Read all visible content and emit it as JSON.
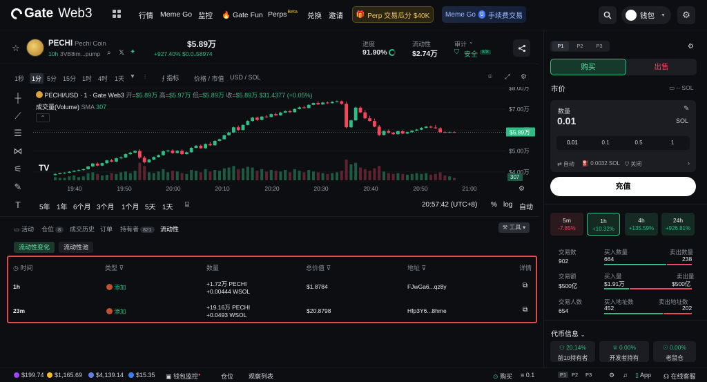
{
  "nav": {
    "brand": "Gate",
    "brand_suffix": "Web3",
    "items": [
      "行情",
      "Meme Go",
      "监控",
      "Gate Fun",
      "Perps",
      "兑换",
      "邀请"
    ],
    "perps_badge": "Beta",
    "perp_banner": "Perp 交易瓜分 $40K",
    "memego_banner_a": "Meme Go",
    "memego_banner_b": "手续费交易",
    "wallet_label": "钱包"
  },
  "token": {
    "symbol": "PECHI",
    "name": "Pechi Coin",
    "age": "10h",
    "address_short": "3VB8im...pump",
    "price": "$5.89万",
    "change": "+927.40%",
    "sub_value": "$0.0₄58974",
    "progress_label": "进度",
    "progress_value": "91.90%",
    "liquidity_label": "流动性",
    "liquidity_value": "$2.74万",
    "audit_label": "审计",
    "audit_value": "安全",
    "audit_count": "8/8"
  },
  "chart_toolbar": {
    "intervals": [
      "1秒",
      "1分",
      "5分",
      "15分",
      "1时",
      "4时",
      "1天"
    ],
    "active_interval": "1分",
    "indicator": "指标",
    "price_mcap": "价格 / 市值",
    "pair_toggle": "USD / SOL"
  },
  "chart_legend": {
    "pair": "PECHI/USD · 1 · Gate Web3",
    "open_label": "开=",
    "open": "$5.89万",
    "high_label": "高=",
    "high": "$5.97万",
    "low_label": "低=",
    "low": "$5.89万",
    "close_label": "收=",
    "close": "$5.89万",
    "change": "$31.4377 (+0.05%)",
    "volume_label": "成交量(Volume)",
    "volume_ma": "SMA",
    "volume_ma_value": "307"
  },
  "chart_data": {
    "type": "candlestick",
    "title": "PECHI/USD · 1 · Gate Web3",
    "y_ticks": [
      "$8.00万",
      "$7.00万",
      "$6.00万",
      "$5.00万",
      "$4.00万"
    ],
    "y_tick_values": [
      80000,
      70000,
      60000,
      50000,
      40000
    ],
    "ylim": [
      36000,
      80500
    ],
    "x_ticks": [
      "19:40",
      "19:50",
      "20:00",
      "20:10",
      "20:20",
      "20:30",
      "20:40",
      "20:50",
      "21:00"
    ],
    "current_price_label": "$5.89万",
    "current_price": 58900,
    "volume_last_label": "307",
    "candles_ohlc": [
      [
        38500,
        39300,
        38300,
        39000
      ],
      [
        39000,
        39600,
        38800,
        39400
      ],
      [
        39400,
        39800,
        39100,
        39600
      ],
      [
        39600,
        40300,
        39400,
        40100
      ],
      [
        40100,
        40800,
        39900,
        40500
      ],
      [
        40500,
        41200,
        40300,
        40900
      ],
      [
        40900,
        41600,
        40500,
        41300
      ],
      [
        41300,
        42900,
        41100,
        42600
      ],
      [
        42600,
        44300,
        42400,
        44000
      ],
      [
        44000,
        44600,
        42700,
        43000
      ],
      [
        43000,
        44400,
        42800,
        44200
      ],
      [
        44200,
        45800,
        43900,
        45500
      ],
      [
        45500,
        46200,
        44600,
        44900
      ],
      [
        44900,
        46800,
        44700,
        46500
      ],
      [
        46500,
        47400,
        46100,
        46900
      ],
      [
        46900,
        48800,
        46600,
        48500
      ],
      [
        48500,
        49600,
        48100,
        49200
      ],
      [
        49200,
        50400,
        48900,
        50000
      ],
      [
        50000,
        50800,
        46200,
        46800
      ],
      [
        46800,
        47600,
        44100,
        44600
      ],
      [
        44600,
        46200,
        44300,
        45900
      ],
      [
        45900,
        47400,
        45600,
        47100
      ],
      [
        47100,
        48300,
        46900,
        48000
      ],
      [
        48000,
        50200,
        47800,
        49900
      ],
      [
        49900,
        50600,
        49400,
        50200
      ],
      [
        50200,
        50800,
        48700,
        49000
      ],
      [
        49000,
        50400,
        48800,
        50100
      ],
      [
        50100,
        50700,
        48200,
        48500
      ],
      [
        48500,
        49700,
        48300,
        49400
      ],
      [
        49400,
        51800,
        49200,
        51500
      ],
      [
        51500,
        52800,
        51300,
        52500
      ],
      [
        52500,
        53100,
        51000,
        51300
      ],
      [
        51300,
        53600,
        51100,
        53300
      ],
      [
        53300,
        54200,
        52400,
        52700
      ],
      [
        52700,
        55100,
        52500,
        54800
      ],
      [
        54800,
        55900,
        54600,
        55600
      ],
      [
        55600,
        57800,
        55400,
        57500
      ],
      [
        57500,
        59200,
        57300,
        58800
      ],
      [
        58800,
        61600,
        58600,
        61300
      ],
      [
        61300,
        62100,
        59600,
        60000
      ],
      [
        60000,
        62700,
        59800,
        62400
      ],
      [
        62400,
        64700,
        62200,
        64300
      ],
      [
        64300,
        66200,
        64100,
        65900
      ],
      [
        65900,
        66400,
        64300,
        64800
      ],
      [
        64800,
        66700,
        64600,
        66400
      ],
      [
        66400,
        67100,
        65800,
        66200
      ],
      [
        66200,
        67900,
        66000,
        67600
      ],
      [
        67600,
        68300,
        66700,
        67000
      ],
      [
        67000,
        68600,
        66800,
        68300
      ],
      [
        68300,
        69300,
        68100,
        69000
      ],
      [
        69000,
        69500,
        68100,
        68500
      ],
      [
        68500,
        70300,
        68300,
        70000
      ],
      [
        70000,
        71200,
        69800,
        70800
      ],
      [
        70800,
        71500,
        70200,
        70500
      ],
      [
        70500,
        72300,
        70300,
        72000
      ],
      [
        72000,
        73100,
        71800,
        72900
      ],
      [
        72900,
        73700,
        71900,
        72200
      ],
      [
        72200,
        73400,
        72000,
        73100
      ],
      [
        73100,
        73600,
        72400,
        72800
      ],
      [
        72800,
        73800,
        72600,
        73400
      ],
      [
        73400,
        74100,
        73100,
        73700
      ],
      [
        73700,
        74100,
        72100,
        72500
      ],
      [
        72500,
        73600,
        60800,
        61300
      ],
      [
        61300,
        64900,
        61000,
        64600
      ],
      [
        64600,
        71100,
        64400,
        70700
      ],
      [
        70700,
        71300,
        68000,
        68400
      ],
      [
        68400,
        69500,
        65200,
        65600
      ],
      [
        65600,
        66800,
        64000,
        64300
      ],
      [
        64300,
        65500,
        61300,
        61600
      ],
      [
        61600,
        62400,
        57100,
        57600
      ],
      [
        57600,
        59800,
        57400,
        59500
      ],
      [
        59500,
        60200,
        58300,
        58700
      ],
      [
        58700,
        59100,
        57700,
        58000
      ],
      [
        58000,
        59700,
        57800,
        59400
      ],
      [
        59400,
        60000,
        58000,
        58300
      ],
      [
        58300,
        59300,
        58100,
        59000
      ],
      [
        59000,
        59900,
        58800,
        59700
      ],
      [
        59700,
        60500,
        59500,
        60200
      ],
      [
        60200,
        61300,
        60000,
        61000
      ],
      [
        61000,
        61900,
        60800,
        61600
      ],
      [
        61600,
        62100,
        60900,
        61200
      ],
      [
        61200,
        62400,
        60500,
        60800
      ],
      [
        60800,
        61300,
        58600,
        59000
      ],
      [
        59000,
        59500,
        58500,
        58900
      ],
      [
        58900,
        59300,
        58700,
        59000
      ],
      [
        59000,
        59400,
        58700,
        58900
      ]
    ],
    "volume": [
      4,
      3,
      3,
      5,
      6,
      4,
      5,
      9,
      10,
      8,
      6,
      7,
      9,
      8,
      10,
      11,
      9,
      12,
      22,
      18,
      10,
      9,
      11,
      14,
      10,
      12,
      11,
      9,
      8,
      13,
      12,
      10,
      14,
      11,
      13,
      12,
      15,
      16,
      18,
      14,
      15,
      17,
      16,
      12,
      14,
      11,
      13,
      12,
      11,
      13,
      10,
      14,
      12,
      10,
      13,
      11,
      10,
      9,
      8,
      9,
      10,
      12,
      26,
      20,
      22,
      16,
      14,
      12,
      15,
      18,
      11,
      9,
      8,
      9,
      8,
      7,
      8,
      9,
      8,
      9,
      7,
      8,
      10,
      6,
      5,
      3
    ]
  },
  "time_ranges": [
    "5年",
    "1年",
    "6个月",
    "3个月",
    "1个月",
    "5天",
    "1天"
  ],
  "chart_footer": {
    "clock": "20:57:42 (UTC+8)",
    "pct": "%",
    "log": "log",
    "auto": "自动"
  },
  "bottom_tabs": [
    {
      "label": "活动"
    },
    {
      "label": "仓位",
      "count": "8"
    },
    {
      "label": "成交历史"
    },
    {
      "label": "订单"
    },
    {
      "label": "持有者",
      "count": "821"
    },
    {
      "label": "流动性"
    }
  ],
  "tools_label": "工具",
  "subtabs": [
    "流动性变化",
    "流动性池"
  ],
  "liquidity_table": {
    "headers": [
      "时间",
      "类型",
      "数量",
      "总价值",
      "地址",
      "详情"
    ],
    "rows": [
      {
        "time": "1h",
        "type": "添加",
        "amount_a": "+1.72万",
        "token_a": "PECHI",
        "amount_b": "+0.00444",
        "token_b": "WSOL",
        "value": "$1.8784",
        "address": "FJwGa6...qz8y"
      },
      {
        "time": "23m",
        "type": "添加",
        "amount_a": "+19.16万",
        "token_a": "PECHI",
        "amount_b": "+0.0493",
        "token_b": "WSOL",
        "value": "$20.8798",
        "address": "Hfp3Y6...8hme"
      }
    ]
  },
  "trade_panel": {
    "presets": [
      "P1",
      "P2",
      "P3"
    ],
    "buy": "购买",
    "sell": "出售",
    "order_type": "市价",
    "balance": "-- SOL",
    "qty_label": "数量",
    "qty_value": "0.01",
    "qty_unit": "SOL",
    "quick_amounts": [
      "0.01",
      "0.1",
      "0.5",
      "1"
    ],
    "auto": "自动",
    "fee": "0.0032 SOL",
    "mev": "关闭",
    "deposit": "充值"
  },
  "timeframes": [
    {
      "label": "5m",
      "change": "-7.85%"
    },
    {
      "label": "1h",
      "change": "+10.32%"
    },
    {
      "label": "4h",
      "change": "+135.59%"
    },
    {
      "label": "24h",
      "change": "+926.81%"
    }
  ],
  "trade_stats": {
    "tx_count_label": "交易数",
    "tx_count": "902",
    "buy_count_label": "买入数量",
    "buy_count": "664",
    "sell_count_label": "卖出数量",
    "sell_count": "238",
    "volume_label": "交易额",
    "volume": "$500亿",
    "buy_vol_label": "买入量",
    "buy_vol": "$1.91万",
    "sell_vol_label": "卖出量",
    "sell_vol": "$500亿",
    "traders_label": "交易人数",
    "traders": "654",
    "buyers_label": "买入地址数",
    "buyers": "452",
    "sellers_label": "卖出地址数",
    "sellers": "202"
  },
  "token_info": {
    "title": "代币信息",
    "items": [
      {
        "value": "20.14%",
        "label": "前10持有者"
      },
      {
        "value": "0.00%",
        "label": "开发者持有"
      },
      {
        "value": "0.00%",
        "label": "老鼠仓"
      }
    ]
  },
  "bottom_bar": {
    "tickers": [
      {
        "price": "$199.74",
        "color": "#9945ff"
      },
      {
        "price": "$1,165.69",
        "color": "#f3ba2f"
      },
      {
        "price": "$4,139.14",
        "color": "#627eea"
      },
      {
        "price": "$15.35",
        "color": "#3b82f6"
      }
    ],
    "wallet_monitor": "钱包监控",
    "positions": "仓位",
    "watchlist": "观察列表",
    "quick_buy": "购买",
    "quick_amt": "0.1",
    "presets": [
      "P1",
      "P2",
      "P3"
    ],
    "app": "App",
    "support": "在线客服"
  }
}
